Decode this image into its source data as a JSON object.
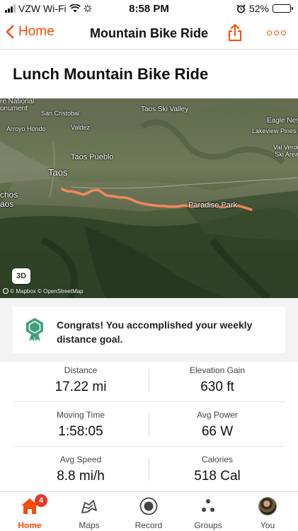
{
  "status_bar": {
    "carrier": "VZW Wi-Fi",
    "time": "8:58 PM",
    "battery": "52%",
    "battery_level": 0.52
  },
  "nav": {
    "back_label": "Home",
    "title": "Mountain Bike Ride"
  },
  "activity": {
    "title": "Lunch Mountain Bike Ride"
  },
  "map": {
    "labels": {
      "national_monument": "re National\nonument",
      "san_cristobal": "San Cristobal",
      "taos_ski_valley": "Taos Ski Valley",
      "eagle_nest": "Eagle Nest",
      "arroyo_hondo": "Arroyo Hondo",
      "valdez": "Valdez",
      "lakeview_pines": "Lakeview Pines",
      "val_verde": "Val Verde\nSki Area",
      "taos_pueblo": "Taos Pueblo",
      "taos": "Taos",
      "ranchos": "chos\naos",
      "paradise_park": "Paradise Park"
    },
    "btn_3d": "3D",
    "attribution": "© Mapbox © OpenStreetMap",
    "route_color": "#fc8a5a"
  },
  "goal": {
    "text": "Congrats! You accomplished your weekly distance goal."
  },
  "stats": {
    "distance": {
      "label": "Distance",
      "value": "17.22 mi"
    },
    "elevation": {
      "label": "Elevation Gain",
      "value": "630 ft"
    },
    "moving_time": {
      "label": "Moving Time",
      "value": "1:58:05"
    },
    "avg_power": {
      "label": "Avg Power",
      "value": "66 W"
    },
    "avg_speed": {
      "label": "Avg Speed",
      "value": "8.8 mi/h"
    },
    "calories": {
      "label": "Calories",
      "value": "518 Cal"
    }
  },
  "tabs": [
    {
      "label": "Home",
      "icon": "home-icon",
      "badge": "4",
      "active": true
    },
    {
      "label": "Maps",
      "icon": "map-icon"
    },
    {
      "label": "Record",
      "icon": "record-icon"
    },
    {
      "label": "Groups",
      "icon": "groups-icon"
    },
    {
      "label": "You",
      "icon": "avatar"
    }
  ],
  "colors": {
    "accent": "#fc4c02",
    "badge": "#e03a2f",
    "goal_icon": "#3fa07a"
  }
}
